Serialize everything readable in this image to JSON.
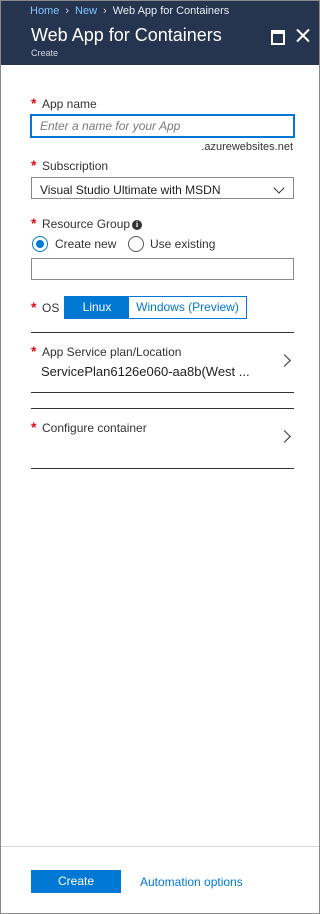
{
  "breadcrumb": {
    "home": "Home",
    "new": "New",
    "current": "Web App for Containers"
  },
  "header": {
    "title": "Web App for Containers",
    "subtitle": "Create"
  },
  "fields": {
    "required_mark": "*",
    "app_name": {
      "label": "App name",
      "placeholder": "Enter a name for your App",
      "suffix": ".azurewebsites.net"
    },
    "subscription": {
      "label": "Subscription",
      "value": "Visual Studio Ultimate with MSDN"
    },
    "resource_group": {
      "label": "Resource Group",
      "create_new": "Create new",
      "use_existing": "Use existing",
      "value": ""
    },
    "os": {
      "label": "OS",
      "linux": "Linux",
      "windows": "Windows (Preview)"
    },
    "app_service_plan": {
      "label": "App Service plan/Location",
      "value": "ServicePlan6126e060-aa8b(West ..."
    },
    "configure_container": {
      "label": "Configure container"
    }
  },
  "footer": {
    "create": "Create",
    "automation": "Automation options"
  },
  "colors": {
    "accent": "#0078d4",
    "header_bg": "#25354f",
    "required": "#e00b1c"
  },
  "icons": [
    "maximize-icon",
    "close-icon",
    "info-icon",
    "chevron-right-icon",
    "chevron-down-icon"
  ]
}
